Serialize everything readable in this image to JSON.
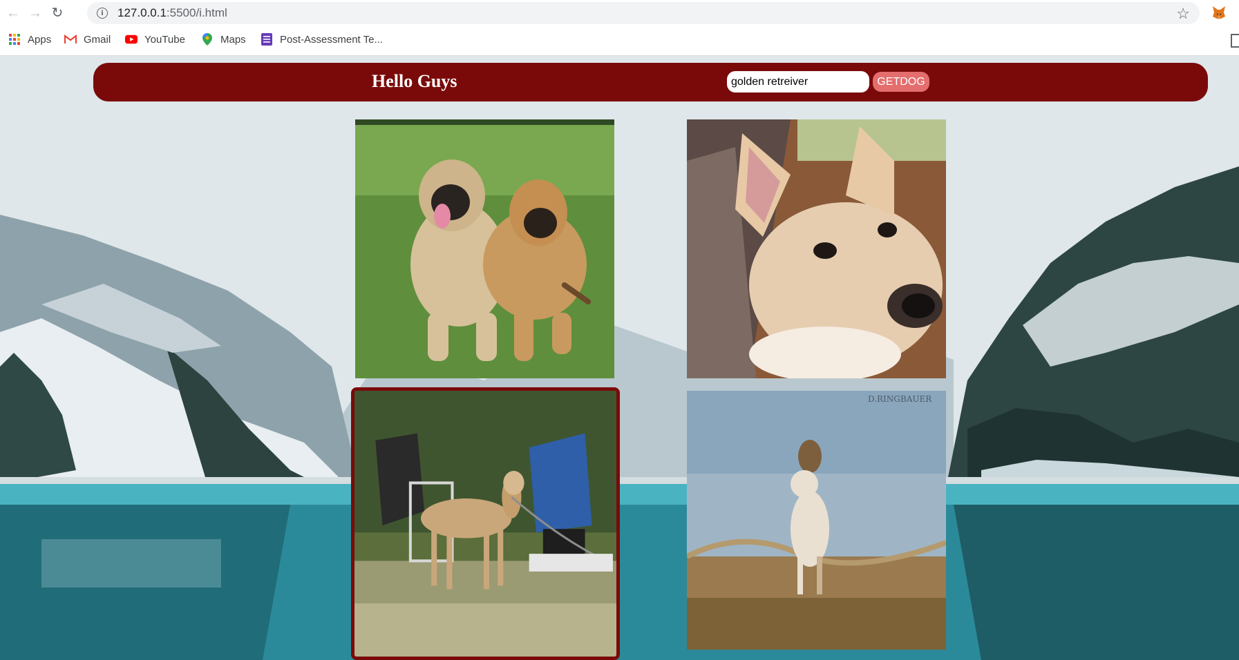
{
  "browser": {
    "url_host": "127.0.0.1",
    "url_path": ":5500/i.html",
    "bookmarks": [
      {
        "label": "Apps",
        "icon": "apps-grid-icon"
      },
      {
        "label": "Gmail",
        "icon": "gmail-icon"
      },
      {
        "label": "YouTube",
        "icon": "youtube-icon"
      },
      {
        "label": "Maps",
        "icon": "maps-pin-icon"
      },
      {
        "label": "Post-Assessment Te...",
        "icon": "forms-icon"
      }
    ]
  },
  "header": {
    "title": "Hello Guys",
    "search_value": "golden retreiver",
    "button_label": "GETDOG",
    "bar_color": "#7a0a0a",
    "button_color": "#e46d6d"
  },
  "gallery": {
    "images": [
      {
        "subject": "two mastiff dogs lying on grass",
        "selected": false
      },
      {
        "subject": "puppy with pointed ears close-up",
        "selected": false
      },
      {
        "subject": "saluki standing near camping chairs",
        "selected": true
      },
      {
        "subject": "whippet standing in dry grass",
        "selected": false,
        "watermark": "D.RINGBAUER"
      }
    ]
  }
}
